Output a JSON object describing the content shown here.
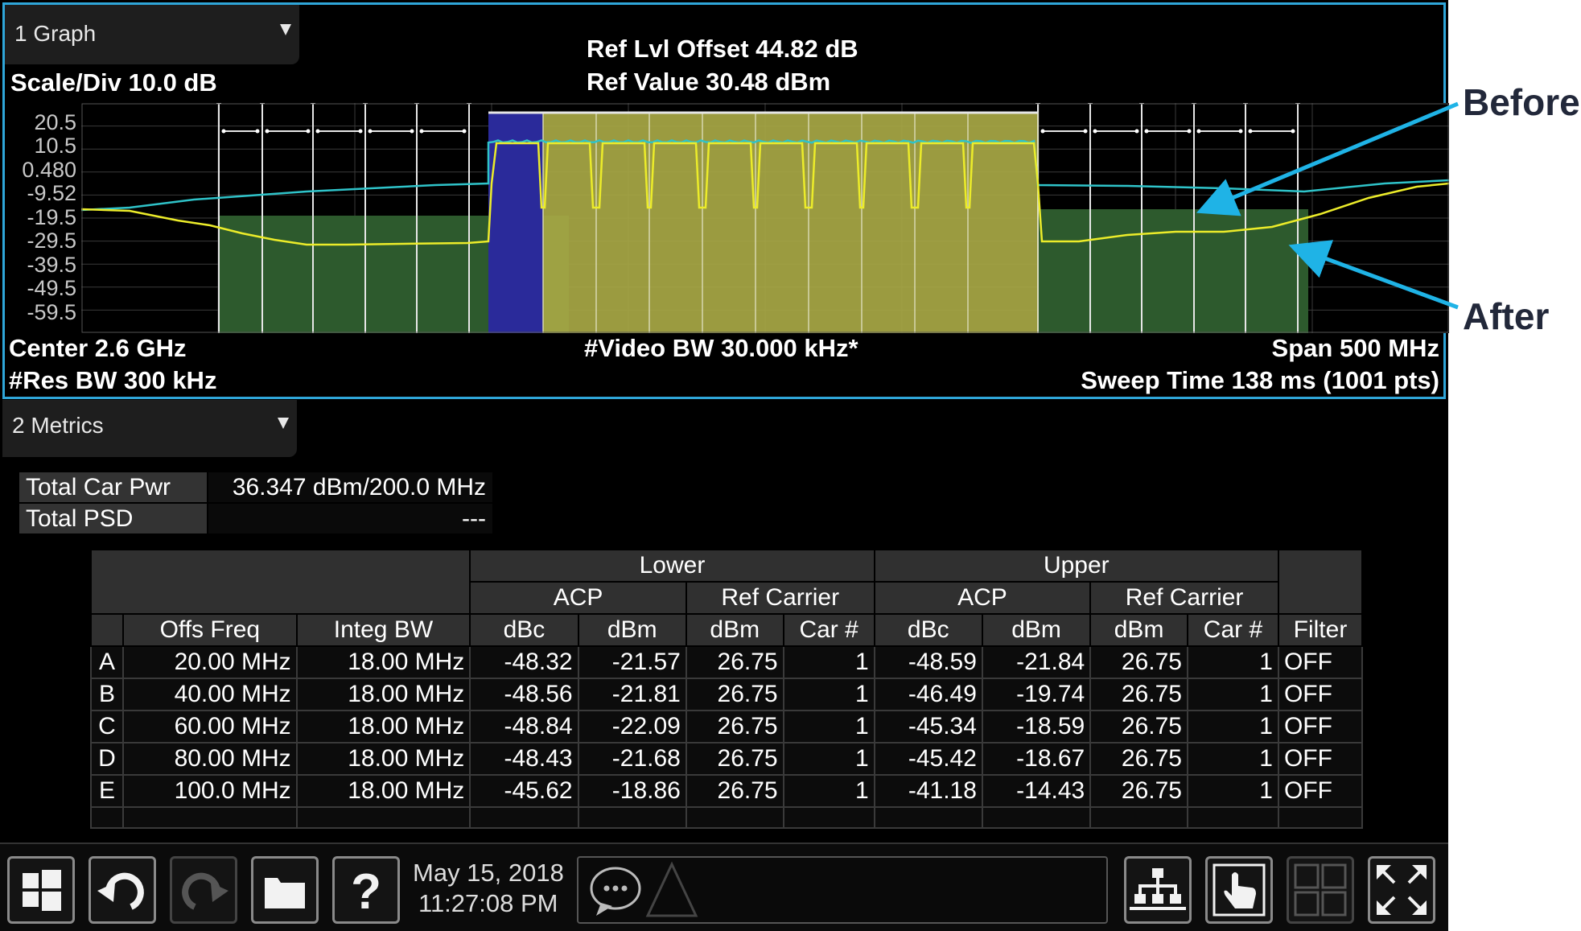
{
  "graph_window": {
    "tab_label": "1 Graph",
    "scale_div": "Scale/Div 10.0 dB",
    "ref_lvl_offset": "Ref Lvl Offset 44.82 dB",
    "ref_value": "Ref Value 30.48 dBm",
    "y_ticks": [
      "20.5",
      "10.5",
      "0.480",
      "-9.52",
      "-19.5",
      "-29.5",
      "-39.5",
      "-49.5",
      "-59.5"
    ],
    "center": "Center 2.6 GHz",
    "res_bw": "#Res BW 300 kHz",
    "video_bw": "#Video BW 30.000 kHz*",
    "span": "Span 500 MHz",
    "sweep_time": "Sweep Time 138 ms (1001 pts)"
  },
  "colors": {
    "frame_border": "#2fa6d9",
    "trace_before": "#2fc3c9",
    "trace_after": "#ecec2a",
    "carrier_fill": "#a8a845",
    "ref_carrier_fill": "#2a2a9a",
    "offset_fill": "#2d5a2d",
    "annotation_arrow": "#1fb3e6"
  },
  "metrics_window": {
    "tab_label": "2 Metrics",
    "summary": [
      {
        "label": "Total Car Pwr",
        "value": "36.347 dBm/200.0 MHz"
      },
      {
        "label": "Total PSD",
        "value": "---"
      }
    ],
    "table": {
      "group_lower": "Lower",
      "group_upper": "Upper",
      "acp": "ACP",
      "ref_carrier": "Ref Carrier",
      "col_offs_freq": "Offs Freq",
      "col_integ_bw": "Integ BW",
      "col_dbc": "dBc",
      "col_dbm": "dBm",
      "col_car": "Car #",
      "col_filter": "Filter",
      "rows": [
        {
          "id": "A",
          "offs": "20.00 MHz",
          "bw": "18.00 MHz",
          "l_dbc": "-48.32",
          "l_dbm": "-21.57",
          "l_ref": "26.75",
          "l_car": "1",
          "u_dbc": "-48.59",
          "u_dbm": "-21.84",
          "u_ref": "26.75",
          "u_car": "1",
          "filter": "OFF"
        },
        {
          "id": "B",
          "offs": "40.00 MHz",
          "bw": "18.00 MHz",
          "l_dbc": "-48.56",
          "l_dbm": "-21.81",
          "l_ref": "26.75",
          "l_car": "1",
          "u_dbc": "-46.49",
          "u_dbm": "-19.74",
          "u_ref": "26.75",
          "u_car": "1",
          "filter": "OFF"
        },
        {
          "id": "C",
          "offs": "60.00 MHz",
          "bw": "18.00 MHz",
          "l_dbc": "-48.84",
          "l_dbm": "-22.09",
          "l_ref": "26.75",
          "l_car": "1",
          "u_dbc": "-45.34",
          "u_dbm": "-18.59",
          "u_ref": "26.75",
          "u_car": "1",
          "filter": "OFF"
        },
        {
          "id": "D",
          "offs": "80.00 MHz",
          "bw": "18.00 MHz",
          "l_dbc": "-48.43",
          "l_dbm": "-21.68",
          "l_ref": "26.75",
          "l_car": "1",
          "u_dbc": "-45.42",
          "u_dbm": "-18.67",
          "u_ref": "26.75",
          "u_car": "1",
          "filter": "OFF"
        },
        {
          "id": "E",
          "offs": "100.0 MHz",
          "bw": "18.00 MHz",
          "l_dbc": "-45.62",
          "l_dbm": "-18.86",
          "l_ref": "26.75",
          "l_car": "1",
          "u_dbc": "-41.18",
          "u_dbm": "-14.43",
          "u_ref": "26.75",
          "u_car": "1",
          "filter": "OFF"
        }
      ]
    }
  },
  "taskbar": {
    "date": "May 15, 2018",
    "time": "11:27:08 PM",
    "icons": [
      "windows-icon",
      "undo-icon",
      "redo-icon",
      "folder-icon",
      "help-icon",
      "chat-icon",
      "warning-icon",
      "network-icon",
      "touch-icon",
      "window-layout-icon",
      "fullscreen-icon"
    ]
  },
  "annotations": {
    "before": "Before",
    "after": "After"
  }
}
